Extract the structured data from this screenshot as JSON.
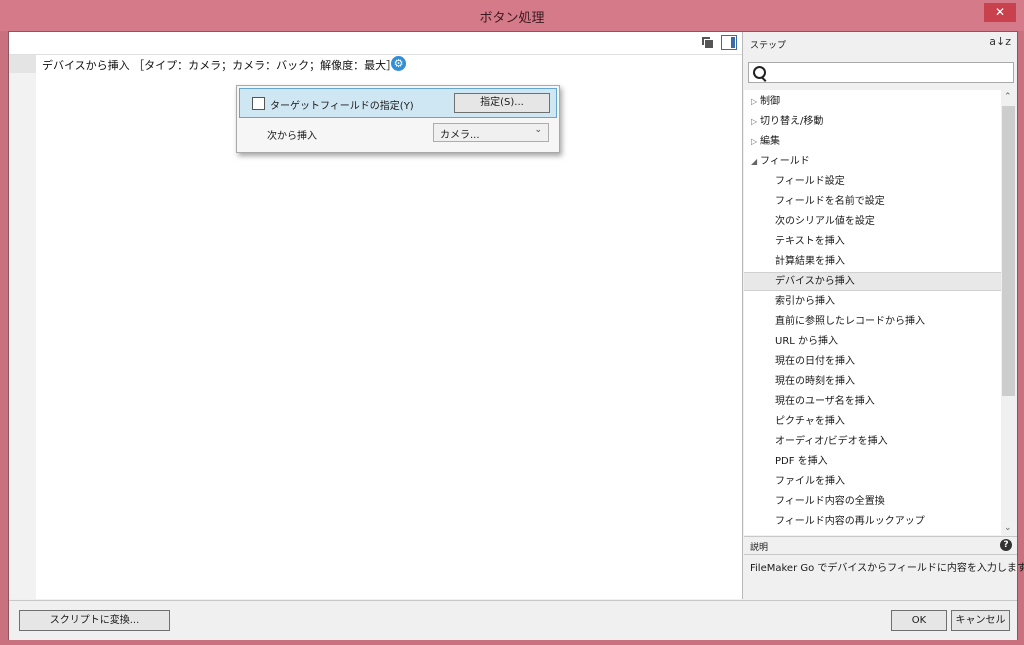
{
  "window": {
    "title": "ボタン処理",
    "close_label": "✕"
  },
  "script": {
    "line1": "デバイスから挿入 ［タイプ：カメラ；カメラ：バック；解像度：最大］"
  },
  "popup": {
    "target_label": "ターゲットフィールドの指定(Y)",
    "specify_button": "指定(S)...",
    "insert_from_label": "次から挿入",
    "insert_from_value": "カメラ..."
  },
  "steps": {
    "title": "ステップ",
    "sort_icon": "a↓z",
    "search_placeholder": "",
    "categories": [
      {
        "label": "制御",
        "expanded": false
      },
      {
        "label": "切り替え/移動",
        "expanded": false
      },
      {
        "label": "編集",
        "expanded": false
      },
      {
        "label": "フィールド",
        "expanded": true
      }
    ],
    "field_items": [
      "フィールド設定",
      "フィールドを名前で設定",
      "次のシリアル値を設定",
      "テキストを挿入",
      "計算結果を挿入",
      "デバイスから挿入",
      "索引から挿入",
      "直前に参照したレコードから挿入",
      "URL から挿入",
      "現在の日付を挿入",
      "現在の時刻を挿入",
      "現在のユーザ名を挿入",
      "ピクチャを挿入",
      "オーディオ/ビデオを挿入",
      "PDF を挿入",
      "ファイルを挿入",
      "フィールド内容の全置換",
      "フィールド内容の再ルックアップ"
    ],
    "selected_item": "デバイスから挿入"
  },
  "description": {
    "title": "説明",
    "text": "FileMaker Go でデバイスからフィールドに内容を入力します。"
  },
  "buttons": {
    "convert": "スクリプトに変換...",
    "ok": "OK",
    "cancel": "キャンセル"
  },
  "colors": {
    "titlebar": "#d57a88",
    "close_button": "#c9414d",
    "popup_highlight": "#cfe6f3",
    "gear": "#2f8fd8"
  }
}
